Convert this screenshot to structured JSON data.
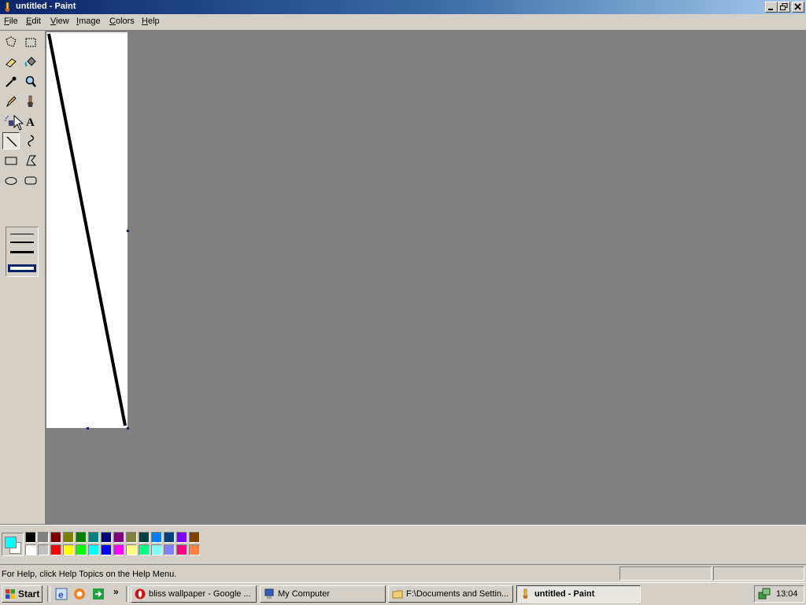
{
  "window": {
    "title": "untitled - Paint"
  },
  "menu": {
    "items": [
      {
        "label": "File",
        "key": "F",
        "rest": "ile"
      },
      {
        "label": "Edit",
        "key": "E",
        "rest": "dit"
      },
      {
        "label": "View",
        "key": "V",
        "rest": "iew"
      },
      {
        "label": "Image",
        "key": "I",
        "rest": "mage"
      },
      {
        "label": "Colors",
        "key": "C",
        "rest": "olors"
      },
      {
        "label": "Help",
        "key": "H",
        "rest": "elp"
      }
    ]
  },
  "tools": [
    {
      "name": "free-form-select",
      "icon": "free-select-icon"
    },
    {
      "name": "select",
      "icon": "rect-select-icon"
    },
    {
      "name": "eraser",
      "icon": "eraser-icon"
    },
    {
      "name": "fill-with-color",
      "icon": "fill-bucket-icon"
    },
    {
      "name": "pick-color",
      "icon": "eyedropper-icon"
    },
    {
      "name": "magnifier",
      "icon": "magnifier-icon"
    },
    {
      "name": "pencil",
      "icon": "pencil-icon"
    },
    {
      "name": "brush",
      "icon": "brush-icon"
    },
    {
      "name": "airbrush",
      "icon": "airbrush-icon"
    },
    {
      "name": "text",
      "icon": "text-icon",
      "glyph": "A"
    },
    {
      "name": "line",
      "icon": "line-icon",
      "selected": true
    },
    {
      "name": "curve",
      "icon": "curve-icon"
    },
    {
      "name": "rectangle",
      "icon": "rectangle-icon"
    },
    {
      "name": "polygon",
      "icon": "polygon-icon"
    },
    {
      "name": "ellipse",
      "icon": "ellipse-icon"
    },
    {
      "name": "rounded-rectangle",
      "icon": "rounded-rect-icon"
    }
  ],
  "line_widths": [
    1,
    2,
    3,
    4
  ],
  "line_width_selected": 4,
  "colors": {
    "foreground": "#00ffff",
    "background": "#ffffff",
    "palette_row1": [
      "#000000",
      "#808080",
      "#800000",
      "#808000",
      "#008000",
      "#008080",
      "#000080",
      "#800080",
      "#808040",
      "#004040",
      "#0080ff",
      "#004080",
      "#8000ff",
      "#804000"
    ],
    "palette_row2": [
      "#ffffff",
      "#c0c0c0",
      "#ff0000",
      "#ffff00",
      "#00ff00",
      "#00ffff",
      "#0000ff",
      "#ff00ff",
      "#ffff80",
      "#00ff80",
      "#80ffff",
      "#8080ff",
      "#ff0080",
      "#ff8040"
    ]
  },
  "status": {
    "help_text": "For Help, click Help Topics on the Help Menu."
  },
  "taskbar": {
    "start_label": "Start",
    "buttons": [
      {
        "label": "bliss wallpaper - Google ...",
        "icon": "opera-icon",
        "active": false
      },
      {
        "label": "My Computer",
        "icon": "my-computer-icon",
        "active": false
      },
      {
        "label": "F:\\Documents and Settin...",
        "icon": "folder-icon",
        "active": false
      },
      {
        "label": "untitled - Paint",
        "icon": "paint-icon",
        "active": true
      }
    ],
    "clock": "13:04"
  }
}
